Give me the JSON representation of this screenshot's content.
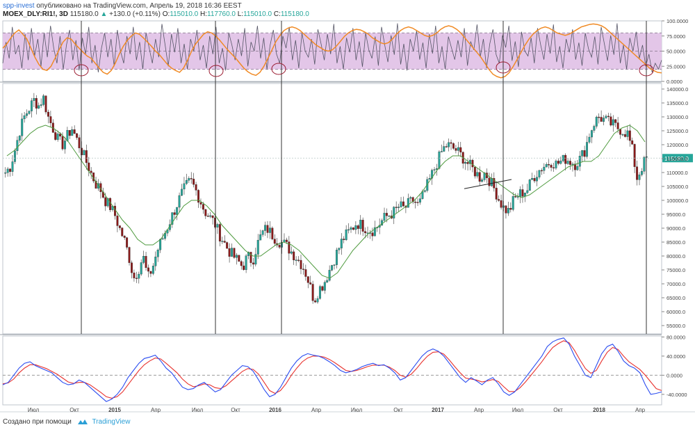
{
  "header": {
    "author": "spp-invest",
    "published_text": "опубликовано на TradingView.com, Апрель 19, 2018 16:36 EEST",
    "symbol": "MOEX_DLY:RI1!, 3D",
    "last": "115180.0",
    "change_arrow": "▲",
    "change": "+130.0 (+0.11%)",
    "open_label": "O:",
    "open": "115010.0",
    "high_label": "H:",
    "high": "117760.0",
    "low_label": "L:",
    "low": "115010.0",
    "close_label": "C:",
    "close": "115180.0"
  },
  "footer": {
    "created_text": "Создано при помощи",
    "brand": "TradingView"
  },
  "colors": {
    "up": "#26a69a",
    "down": "#8b1a1a",
    "ma": "#4e9a3e",
    "osc_thin": "#555566",
    "osc_orange": "#f08a24",
    "osc_band": "#e3c6e8",
    "macd_blue": "#2a4cf0",
    "macd_red": "#e8312d",
    "price_tag": "#26a69a"
  },
  "chart_data": [
    {
      "type": "line",
      "panel": "oscillator",
      "yticks": [
        "100.0000",
        "75.0000",
        "50.0000",
        "25.0000",
        "0.0000"
      ],
      "ylim": [
        0,
        100
      ],
      "band": [
        20,
        80
      ],
      "series": [
        {
          "values": [
            30,
            65,
            38,
            90,
            45,
            60,
            22,
            78,
            35,
            88,
            42,
            70,
            25,
            80,
            40,
            92,
            55,
            30,
            75,
            20,
            60,
            85,
            35,
            68,
            18,
            72,
            45,
            90,
            30,
            60,
            15,
            55,
            80,
            40,
            70,
            25,
            85,
            50,
            30,
            75,
            45,
            90,
            35,
            65,
            20,
            80,
            55,
            30,
            70,
            40,
            95,
            60,
            25,
            78,
            48,
            88,
            30,
            62,
            20,
            70,
            50,
            85,
            35,
            60,
            22,
            75,
            45,
            90,
            30,
            55,
            18,
            80,
            60,
            35,
            70,
            42,
            88,
            25,
            65,
            50,
            92,
            38,
            72,
            20,
            60,
            85,
            45,
            30,
            75,
            55,
            90,
            35,
            68,
            22,
            80,
            50,
            40,
            70,
            28,
            86,
            62,
            35,
            78,
            45,
            95,
            30,
            58,
            20,
            72,
            48,
            88,
            35,
            66,
            24,
            80,
            52,
            38,
            74,
            26,
            90,
            60,
            32,
            76,
            44,
            96,
            28,
            62,
            18,
            70,
            50,
            84,
            36,
            64,
            22,
            78,
            46,
            92,
            30,
            58,
            20,
            74,
            55,
            36,
            68,
            40,
            88,
            26,
            66,
            52,
            94,
            40,
            70,
            22,
            62,
            86,
            44,
            30,
            76,
            56,
            92,
            34,
            66,
            24,
            82,
            50,
            42,
            72,
            30,
            88,
            60,
            36,
            78,
            46,
            94,
            32,
            58,
            22,
            70,
            48,
            86,
            36,
            64,
            26,
            80,
            54,
            40,
            74,
            28,
            90,
            62,
            34,
            76,
            44,
            96,
            30,
            60,
            20,
            72,
            50,
            82,
            38,
            60,
            25,
            45,
            15,
            30,
            20,
            35
          ]
        },
        {
          "values": [
            55,
            62,
            72,
            80,
            85,
            78,
            70,
            55,
            40,
            28,
            20,
            18,
            25,
            38,
            52,
            65,
            72,
            70,
            62,
            55,
            48,
            42,
            38,
            30,
            22,
            15,
            12,
            18,
            30,
            45,
            58,
            68,
            75,
            80,
            78,
            72,
            65,
            58,
            50,
            44,
            36,
            28,
            22,
            18,
            15,
            22,
            35,
            50,
            62,
            70,
            78,
            82,
            80,
            75,
            68,
            60,
            52,
            45,
            38,
            30,
            22,
            16,
            12,
            10,
            15,
            25,
            38,
            52,
            66,
            76,
            84,
            88,
            90,
            88,
            84,
            78,
            72,
            66,
            60,
            56,
            52,
            50,
            52,
            58,
            66,
            74,
            80,
            84,
            86,
            85,
            82,
            78,
            72,
            68,
            64,
            62,
            64,
            70,
            78,
            84,
            88,
            90,
            88,
            84,
            80,
            76,
            74,
            76,
            80,
            86,
            90,
            92,
            90,
            86,
            80,
            72,
            64,
            56,
            48,
            40,
            30,
            20,
            12,
            8,
            6,
            8,
            14,
            24,
            36,
            48,
            60,
            70,
            78,
            84,
            88,
            90,
            88,
            84,
            80,
            78,
            76,
            78,
            82,
            86,
            90,
            92,
            94,
            95,
            94,
            92,
            88,
            82,
            76,
            70,
            64,
            58,
            52,
            46,
            40,
            34,
            28,
            22,
            18,
            15,
            14
          ]
        }
      ],
      "marked_troughs": 6
    },
    {
      "type": "candlestick",
      "panel": "price",
      "yticks": [
        "140000.0",
        "135000.0",
        "130000.0",
        "125000.0",
        "120000.0",
        "115000.0",
        "110000.0",
        "105000.0",
        "100000.0",
        "95000.0",
        "90000.0",
        "85000.0",
        "80000.0",
        "75000.0",
        "70000.0",
        "65000.0",
        "60000.0",
        "55000.0"
      ],
      "ylim": [
        52000,
        142000
      ],
      "last_price_label": "115180.0",
      "close_path": [
        110000,
        112000,
        118000,
        125000,
        130000,
        133000,
        136000,
        134000,
        137000,
        130000,
        126000,
        122000,
        120000,
        123000,
        126000,
        122000,
        118000,
        114000,
        110000,
        106000,
        104000,
        100000,
        98000,
        95000,
        90000,
        86000,
        80000,
        72000,
        75000,
        80000,
        72000,
        76000,
        82000,
        86000,
        90000,
        94000,
        98000,
        102000,
        105000,
        107000,
        104000,
        100000,
        96000,
        94000,
        92000,
        88000,
        85000,
        82000,
        80000,
        78000,
        76000,
        80000,
        78000,
        84000,
        88000,
        90000,
        88000,
        86000,
        85000,
        84000,
        82000,
        80000,
        78000,
        75000,
        70000,
        64000,
        68000,
        70000,
        74000,
        78000,
        82000,
        86000,
        88000,
        90000,
        92000,
        91000,
        90000,
        89000,
        90000,
        92000,
        94000,
        95000,
        96000,
        98000,
        97000,
        99000,
        100000,
        98000,
        102000,
        106000,
        110000,
        114000,
        118000,
        120000,
        119000,
        118000,
        116000,
        114000,
        112000,
        110000,
        108000,
        110000,
        107000,
        104000,
        100000,
        97000,
        96000,
        100000,
        102000,
        103000,
        104000,
        108000,
        110000,
        112000,
        113000,
        114000,
        113000,
        114000,
        115000,
        114000,
        113000,
        115000,
        118000,
        124000,
        128000,
        130000,
        129000,
        128000,
        127000,
        126000,
        125000,
        124000,
        118000,
        108000,
        112000,
        115180
      ],
      "ma_path": [
        116000,
        118000,
        121000,
        124000,
        126000,
        127000,
        126000,
        124000,
        121000,
        117000,
        113000,
        109000,
        105000,
        101000,
        97000,
        93000,
        90000,
        86000,
        84000,
        84000,
        86000,
        90000,
        94000,
        98000,
        100000,
        100000,
        98000,
        95000,
        91000,
        88000,
        85000,
        82000,
        80000,
        80000,
        82000,
        84000,
        85000,
        84000,
        82000,
        79000,
        76000,
        73000,
        72000,
        74000,
        78000,
        82000,
        85000,
        88000,
        90000,
        92000,
        94000,
        96000,
        98000,
        100000,
        103000,
        107000,
        111000,
        114000,
        116000,
        116000,
        114000,
        112000,
        110000,
        108000,
        106000,
        104000,
        102000,
        101000,
        102000,
        104000,
        106000,
        108000,
        110000,
        112000,
        113000,
        114000,
        114000,
        116000,
        120000,
        124000,
        126000,
        127000,
        125000,
        121000
      ],
      "trendline": "support line from Feb 2017 to Jun 2017"
    },
    {
      "type": "line",
      "panel": "macd",
      "yticks": [
        "80.0000",
        "40.0000",
        "0.0000",
        "-40.0000"
      ],
      "ylim": [
        -62,
        82
      ],
      "series": [
        {
          "values": [
            -20,
            -15,
            0,
            15,
            25,
            28,
            20,
            15,
            10,
            5,
            -5,
            -15,
            -20,
            -18,
            -10,
            -15,
            -25,
            -35,
            -45,
            -55,
            -50,
            -40,
            -25,
            -5,
            10,
            25,
            35,
            38,
            42,
            30,
            15,
            5,
            -10,
            -25,
            -30,
            -28,
            -20,
            -15,
            -25,
            -35,
            -30,
            -15,
            0,
            10,
            20,
            18,
            8,
            -10,
            -30,
            -45,
            -40,
            -25,
            -5,
            15,
            30,
            40,
            45,
            42,
            40,
            35,
            28,
            20,
            10,
            5,
            8,
            12,
            18,
            22,
            25,
            20,
            22,
            15,
            5,
            -10,
            -5,
            10,
            25,
            40,
            50,
            55,
            50,
            40,
            25,
            10,
            -5,
            -15,
            -5,
            -12,
            -20,
            -10,
            -5,
            -18,
            -35,
            -42,
            -35,
            -20,
            -5,
            10,
            25,
            40,
            60,
            70,
            75,
            78,
            65,
            40,
            20,
            0,
            -5,
            20,
            45,
            60,
            65,
            50,
            30,
            20,
            15,
            5,
            -20,
            -40,
            -38,
            -35
          ]
        },
        {
          "values": [
            -18,
            -16,
            -8,
            5,
            15,
            22,
            22,
            18,
            14,
            8,
            2,
            -6,
            -14,
            -17,
            -15,
            -15,
            -20,
            -28,
            -36,
            -45,
            -48,
            -45,
            -35,
            -20,
            -5,
            10,
            22,
            30,
            36,
            34,
            25,
            15,
            5,
            -8,
            -18,
            -24,
            -22,
            -18,
            -20,
            -26,
            -28,
            -22,
            -12,
            -2,
            8,
            14,
            12,
            2,
            -15,
            -32,
            -38,
            -32,
            -18,
            0,
            15,
            28,
            36,
            40,
            40,
            38,
            33,
            26,
            18,
            10,
            8,
            10,
            14,
            18,
            21,
            21,
            21,
            17,
            10,
            0,
            -4,
            2,
            14,
            28,
            40,
            48,
            49,
            44,
            32,
            18,
            5,
            -6,
            -8,
            -10,
            -14,
            -12,
            -9,
            -13,
            -24,
            -34,
            -34,
            -26,
            -14,
            0,
            14,
            28,
            44,
            58,
            66,
            72,
            68,
            52,
            32,
            14,
            4,
            10,
            30,
            48,
            58,
            54,
            40,
            28,
            20,
            12,
            0,
            -14,
            -28,
            -32
          ]
        }
      ]
    }
  ],
  "x_axis": {
    "labels": [
      "Июл",
      "Окт",
      "2015",
      "Апр",
      "Июл",
      "Окт",
      "2016",
      "Апр",
      "Июл",
      "Окт",
      "2017",
      "Апр",
      "Июл",
      "Окт",
      "2018",
      "Апр"
    ]
  }
}
